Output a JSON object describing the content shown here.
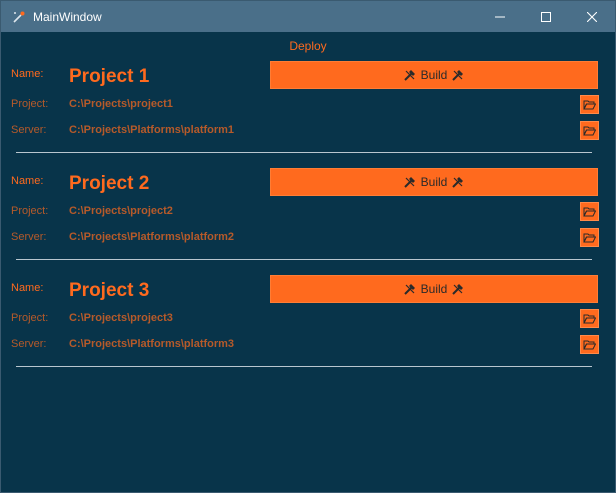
{
  "window": {
    "title": "MainWindow"
  },
  "header": {
    "deploy_label": "Deploy"
  },
  "labels": {
    "name": "Name:",
    "project": "Project:",
    "server": "Server:"
  },
  "projects": [
    {
      "name": "Project 1",
      "project_path": "C:\\Projects\\project1",
      "server_path": "C:\\Projects\\Platforms\\platform1",
      "build_label": "Build"
    },
    {
      "name": "Project 2",
      "project_path": "C:\\Projects\\project2",
      "server_path": "C:\\Projects\\Platforms\\platform2",
      "build_label": "Build"
    },
    {
      "name": "Project 3",
      "project_path": "C:\\Projects\\project3",
      "server_path": "C:\\Projects\\Platforms\\platform3",
      "build_label": "Build"
    }
  ],
  "icons": {
    "app": "app-icon",
    "minimize": "minimize-icon",
    "maximize": "maximize-icon",
    "close": "close-icon",
    "build": "tools-icon",
    "browse": "folder-open-icon"
  },
  "colors": {
    "background": "#08344a",
    "titlebar": "#4a6f89",
    "accent": "#ff6a1e",
    "dim_text": "#b65a2a",
    "divider": "#b8c6cf"
  }
}
